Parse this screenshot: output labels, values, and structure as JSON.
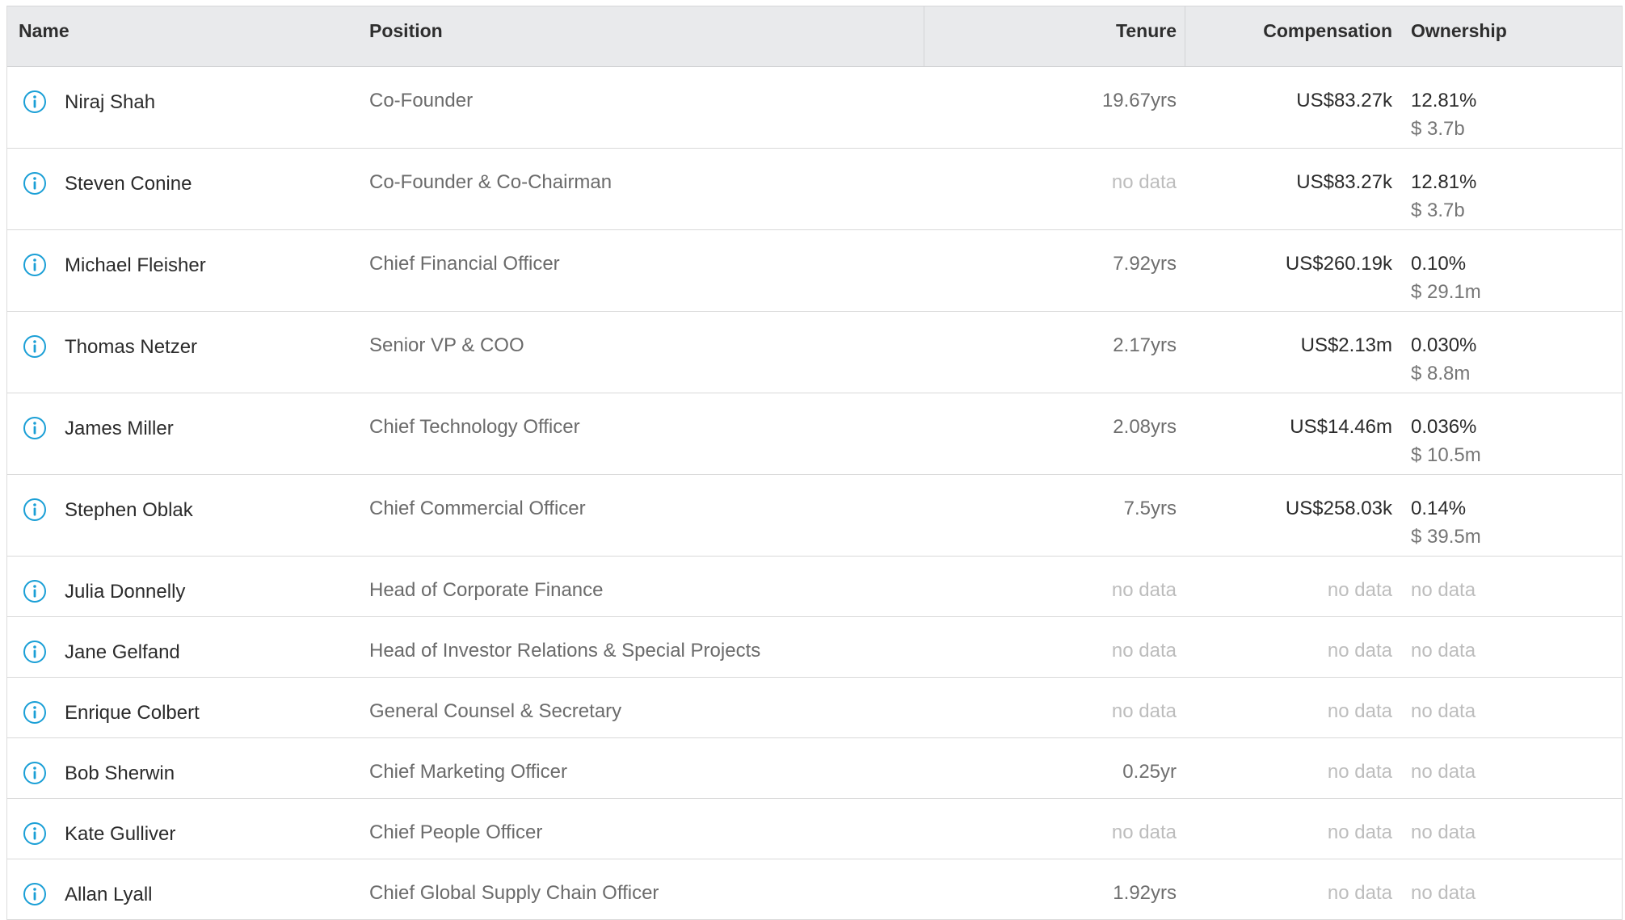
{
  "colors": {
    "icon": "#1a9fd6",
    "header_bg": "#e9eaec",
    "nodata": "#bdbdbd"
  },
  "header": {
    "name": "Name",
    "position": "Position",
    "tenure": "Tenure",
    "compensation": "Compensation",
    "ownership": "Ownership"
  },
  "rows": [
    {
      "name": "Niraj Shah",
      "position": "Co-Founder",
      "tenure": "19.67yrs",
      "compensation": "US$83.27k",
      "ownership_pct": "12.81%",
      "ownership_value": "$ 3.7b"
    },
    {
      "name": "Steven Conine",
      "position": "Co-Founder & Co-Chairman",
      "tenure": "no data",
      "compensation": "US$83.27k",
      "ownership_pct": "12.81%",
      "ownership_value": "$ 3.7b"
    },
    {
      "name": "Michael Fleisher",
      "position": "Chief Financial Officer",
      "tenure": "7.92yrs",
      "compensation": "US$260.19k",
      "ownership_pct": "0.10%",
      "ownership_value": "$ 29.1m"
    },
    {
      "name": "Thomas Netzer",
      "position": "Senior VP & COO",
      "tenure": "2.17yrs",
      "compensation": "US$2.13m",
      "ownership_pct": "0.030%",
      "ownership_value": "$ 8.8m"
    },
    {
      "name": "James Miller",
      "position": "Chief Technology Officer",
      "tenure": "2.08yrs",
      "compensation": "US$14.46m",
      "ownership_pct": "0.036%",
      "ownership_value": "$ 10.5m"
    },
    {
      "name": "Stephen Oblak",
      "position": "Chief Commercial Officer",
      "tenure": "7.5yrs",
      "compensation": "US$258.03k",
      "ownership_pct": "0.14%",
      "ownership_value": "$ 39.5m"
    },
    {
      "name": "Julia Donnelly",
      "position": "Head of Corporate Finance",
      "tenure": "no data",
      "compensation": "no data",
      "ownership_pct": "no data",
      "ownership_value": ""
    },
    {
      "name": "Jane Gelfand",
      "position": "Head of Investor Relations & Special Projects",
      "tenure": "no data",
      "compensation": "no data",
      "ownership_pct": "no data",
      "ownership_value": ""
    },
    {
      "name": "Enrique Colbert",
      "position": "General Counsel & Secretary",
      "tenure": "no data",
      "compensation": "no data",
      "ownership_pct": "no data",
      "ownership_value": ""
    },
    {
      "name": "Bob Sherwin",
      "position": "Chief Marketing Officer",
      "tenure": "0.25yr",
      "compensation": "no data",
      "ownership_pct": "no data",
      "ownership_value": ""
    },
    {
      "name": "Kate Gulliver",
      "position": "Chief People Officer",
      "tenure": "no data",
      "compensation": "no data",
      "ownership_pct": "no data",
      "ownership_value": ""
    },
    {
      "name": "Allan Lyall",
      "position": "Chief Global Supply Chain Officer",
      "tenure": "1.92yrs",
      "compensation": "no data",
      "ownership_pct": "no data",
      "ownership_value": ""
    }
  ]
}
